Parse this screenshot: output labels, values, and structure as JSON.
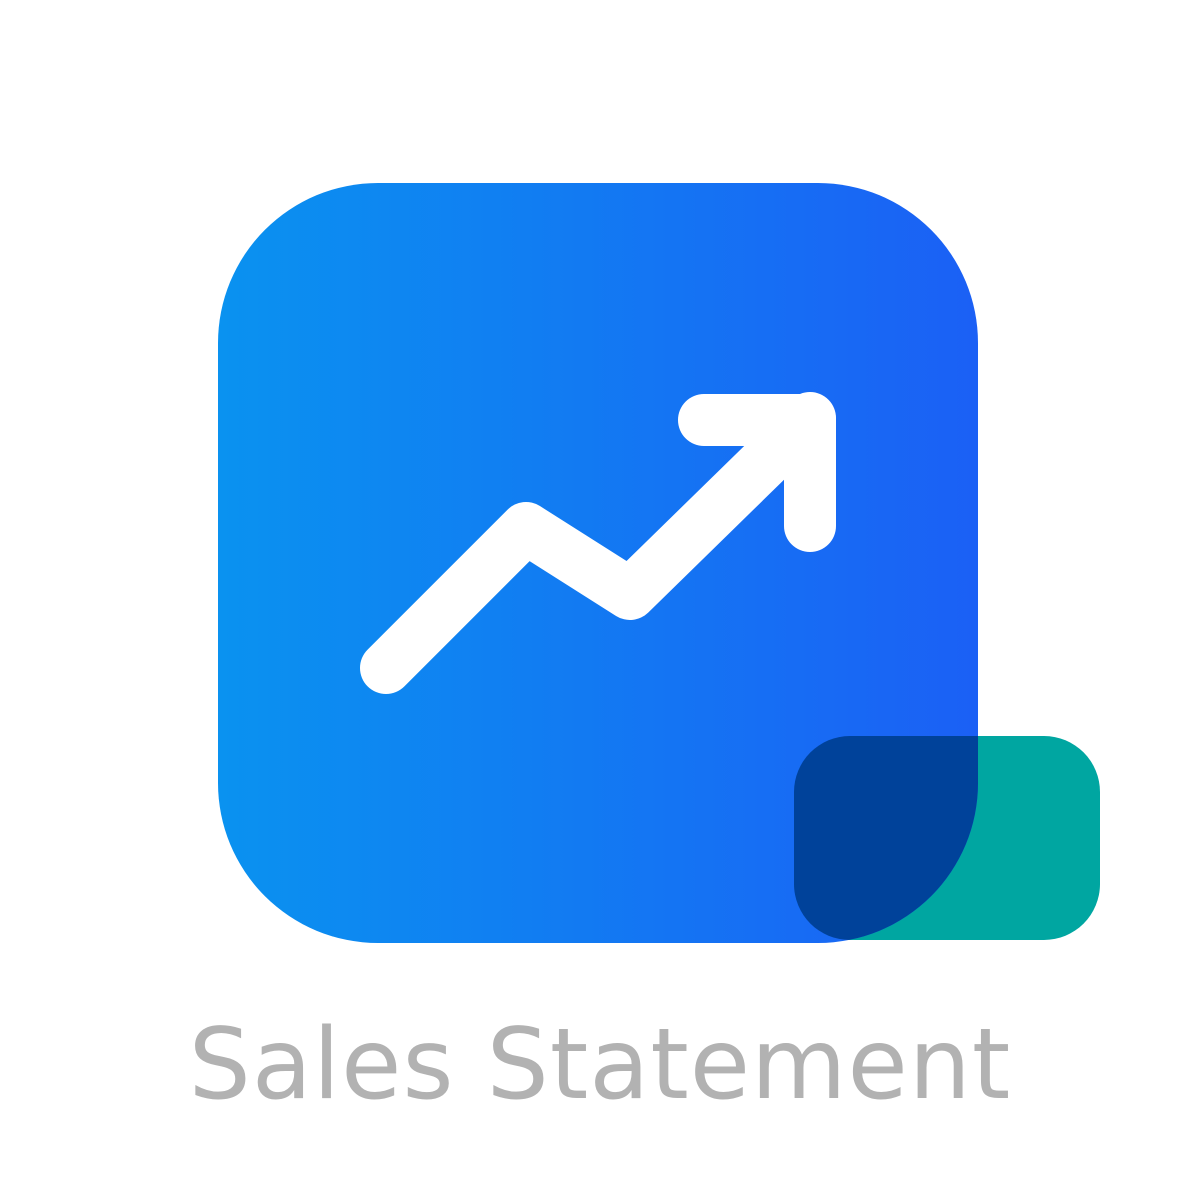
{
  "app": {
    "name": "Sales Statement"
  },
  "icon": {
    "glyph": "trending-up-icon",
    "badge": "rounded-rect-badge"
  },
  "colors": {
    "tile_gradient_start": "#0a92f0",
    "tile_gradient_end": "#1b60f5",
    "badge": "#00a6a1",
    "badge_overlap": "#00429a",
    "glyph": "#ffffff",
    "label": "#b2b2b2",
    "background": "#ffffff"
  }
}
